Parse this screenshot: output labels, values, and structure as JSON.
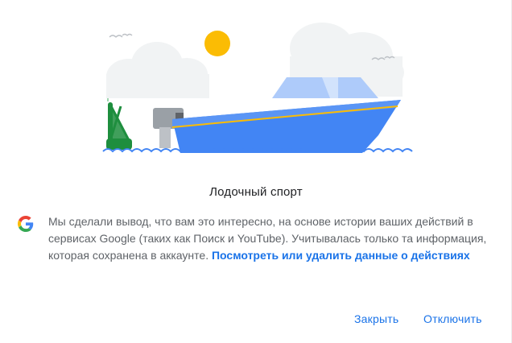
{
  "dialog": {
    "illustration_icon": "boat-illustration",
    "topic_title": "Лодочный спорт",
    "info_icon": "google-g-icon",
    "info_text": "Мы сделали вывод, что вам это интересно, на основе истории ваших действий в сервисах Google (таких как Поиск и YouTube). Учитывалась только та информация, которая сохранена в аккаунте.",
    "info_link": "Посмотреть или удалить данные о действиях",
    "close_label": "Закрыть",
    "disable_label": "Отключить"
  },
  "colors": {
    "accent": "#1a73e8",
    "title": "#202124",
    "body_text": "#5f6368",
    "boat_blue": "#4285f4",
    "sun": "#fbbc04",
    "buoy_green": "#1e8e3e"
  }
}
